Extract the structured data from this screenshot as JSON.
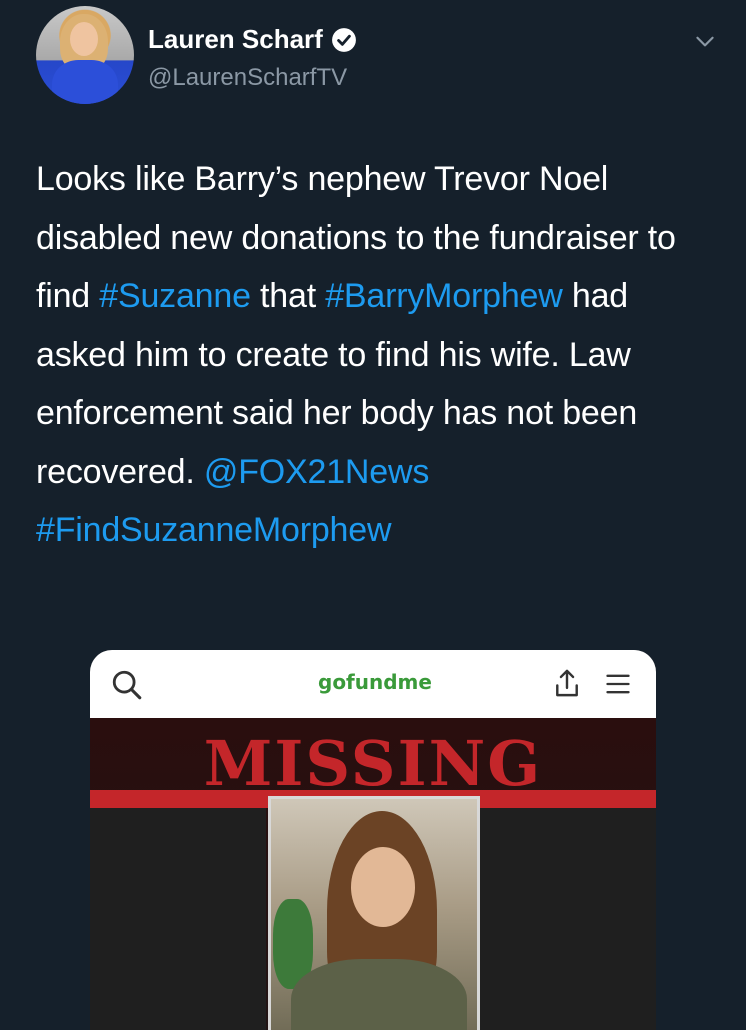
{
  "author": {
    "name": "Lauren Scharf",
    "handle": "@LaurenScharfTV",
    "verified": true
  },
  "tweet": {
    "segments": [
      {
        "text": "Looks like Barry’s nephew Trevor Noel disabled new donations to the fundraiser to find ",
        "link": false
      },
      {
        "text": "#Suzanne",
        "link": true
      },
      {
        "text": " that ",
        "link": false
      },
      {
        "text": "#BarryMorphew",
        "link": true
      },
      {
        "text": " had asked him to create to find his wife. Law enforcement said her body has not been recovered. ",
        "link": false
      },
      {
        "text": "@FOX21News",
        "link": true
      },
      {
        "text": " ",
        "link": false
      },
      {
        "text": "#FindSuzanneMorphew",
        "link": true
      }
    ]
  },
  "media": {
    "site_logo": "gofundme",
    "poster_title": "MISSING",
    "icons": [
      "search-icon",
      "share-icon",
      "menu-icon"
    ]
  },
  "colors": {
    "background": "#15202b",
    "link": "#1d9bf0",
    "muted": "#8b98a5",
    "missing_red": "#c4262a",
    "gofundme_green": "#3a9a3a"
  }
}
